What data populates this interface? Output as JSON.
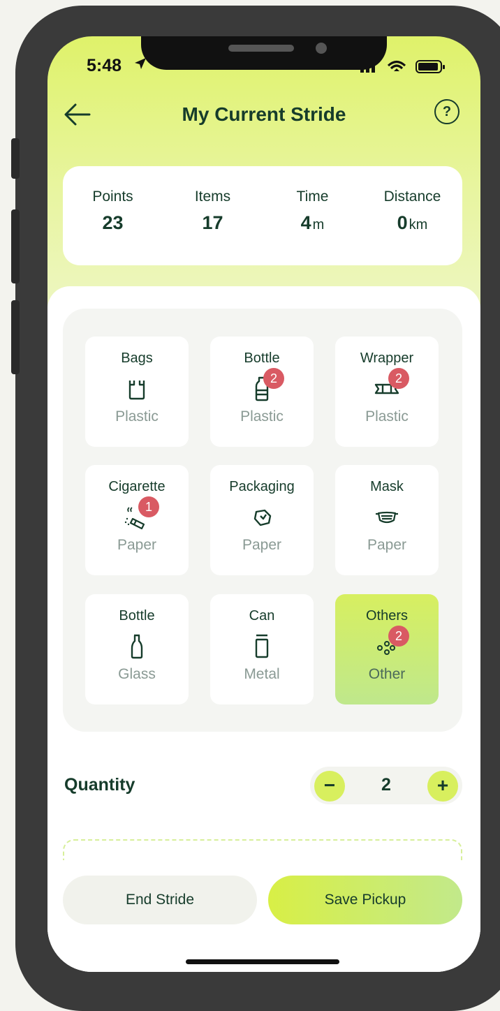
{
  "status": {
    "time": "5:48"
  },
  "header": {
    "title": "My Current Stride",
    "help": "?"
  },
  "stats": [
    {
      "label": "Points",
      "value": "23",
      "unit": ""
    },
    {
      "label": "Items",
      "value": "17",
      "unit": ""
    },
    {
      "label": "Time",
      "value": "4",
      "unit": "m"
    },
    {
      "label": "Distance",
      "value": "0",
      "unit": "km"
    }
  ],
  "categories": [
    {
      "name": "Bags",
      "material": "Plastic",
      "icon": "bag-icon",
      "badge": ""
    },
    {
      "name": "Bottle",
      "material": "Plastic",
      "icon": "plastic-bottle-icon",
      "badge": "2"
    },
    {
      "name": "Wrapper",
      "material": "Plastic",
      "icon": "wrapper-icon",
      "badge": "2"
    },
    {
      "name": "Cigarette",
      "material": "Paper",
      "icon": "cigarette-icon",
      "badge": "1"
    },
    {
      "name": "Packaging",
      "material": "Paper",
      "icon": "packaging-icon",
      "badge": ""
    },
    {
      "name": "Mask",
      "material": "Paper",
      "icon": "mask-icon",
      "badge": ""
    },
    {
      "name": "Bottle",
      "material": "Glass",
      "icon": "glass-bottle-icon",
      "badge": ""
    },
    {
      "name": "Can",
      "material": "Metal",
      "icon": "can-icon",
      "badge": ""
    },
    {
      "name": "Others",
      "material": "Other",
      "icon": "others-icon",
      "badge": "2"
    }
  ],
  "quantity": {
    "label": "Quantity",
    "value": "2",
    "minus": "−",
    "plus": "+"
  },
  "actions": {
    "end": "End Stride",
    "save": "Save Pickup"
  },
  "colors": {
    "accent": "#d8ef5e",
    "text": "#163c2b",
    "badge": "#d95a63"
  }
}
